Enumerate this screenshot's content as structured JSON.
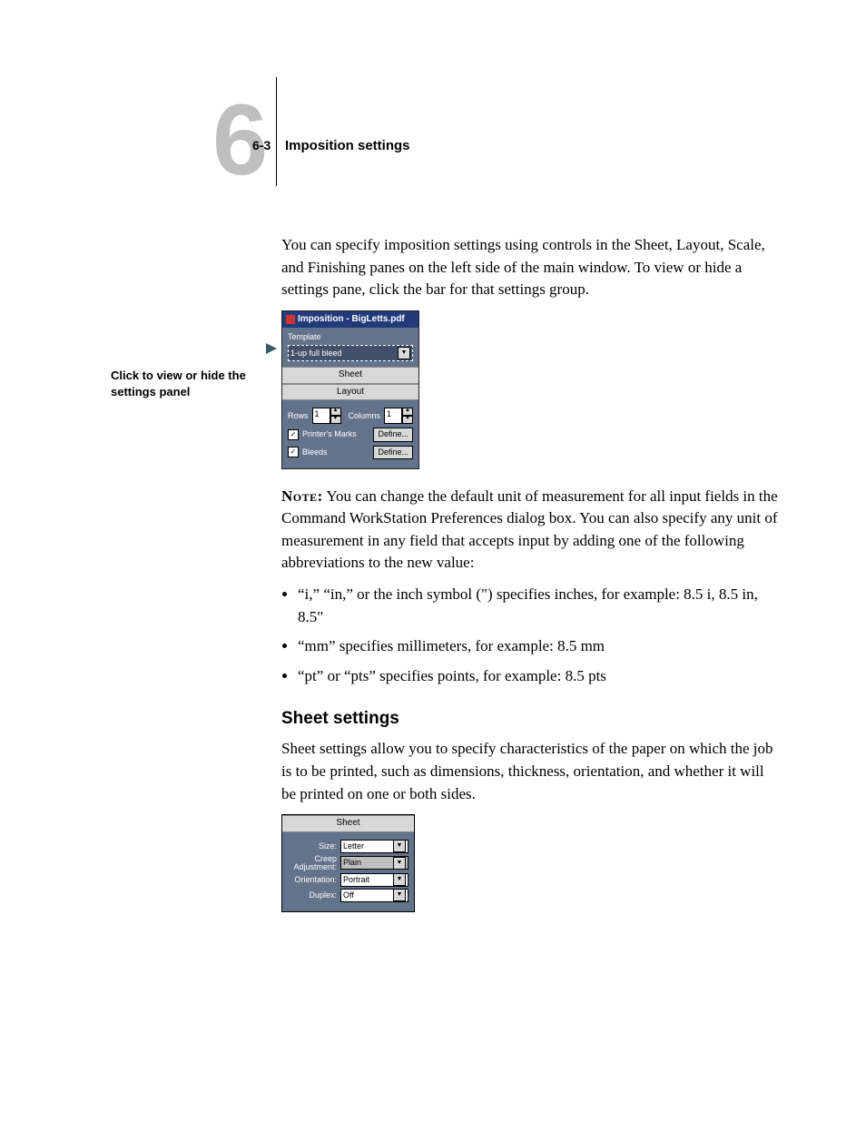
{
  "header": {
    "chapter_number": "6",
    "page_ref": "6-3",
    "title": "Imposition settings"
  },
  "side_caption": "Click to view or hide the settings panel",
  "paragraphs": {
    "intro": "You can specify imposition settings using controls in the Sheet, Layout, Scale, and Finishing panes on the left side of the main window. To view or hide a settings pane, click the bar for that settings group.",
    "note_label": "Note:",
    "note_body": " You can change the default unit of measurement for all input fields in the Command WorkStation Preferences dialog box. You can also specify any unit of measurement in any field that accepts input by adding one of the following abbreviations to the new value:",
    "sheet_heading": "Sheet settings",
    "sheet_body": "Sheet settings allow you to specify characteristics of the paper on which the job is to be printed, such as dimensions, thickness, orientation, and whether it will be printed on one or both sides."
  },
  "bullets": [
    "“i,” “in,” or the inch symbol (\") specifies inches, for example: 8.5 i, 8.5 in, 8.5\"",
    "“mm” specifies millimeters, for example: 8.5 mm",
    "“pt” or “pts” specifies points, for example: 8.5 pts"
  ],
  "panel1": {
    "titlebar": "Imposition - BigLetts.pdf",
    "template_label": "Template",
    "template_value": "1-up full bleed",
    "sheet_bar": "Sheet",
    "layout_bar": "Layout",
    "rows_label": "Rows",
    "rows_value": "1",
    "columns_label": "Columns",
    "columns_value": "1",
    "printers_marks_label": "Printer's Marks",
    "bleeds_label": "Bleeds",
    "define_label": "Define..."
  },
  "panel2": {
    "bar": "Sheet",
    "rows": [
      {
        "label": "Size:",
        "value": "Letter",
        "disabled": false
      },
      {
        "label": "Creep Adjustment:",
        "value": "Plain",
        "disabled": true
      },
      {
        "label": "Orientation:",
        "value": "Portrait",
        "disabled": false
      },
      {
        "label": "Duplex:",
        "value": "Off",
        "disabled": false
      }
    ]
  }
}
